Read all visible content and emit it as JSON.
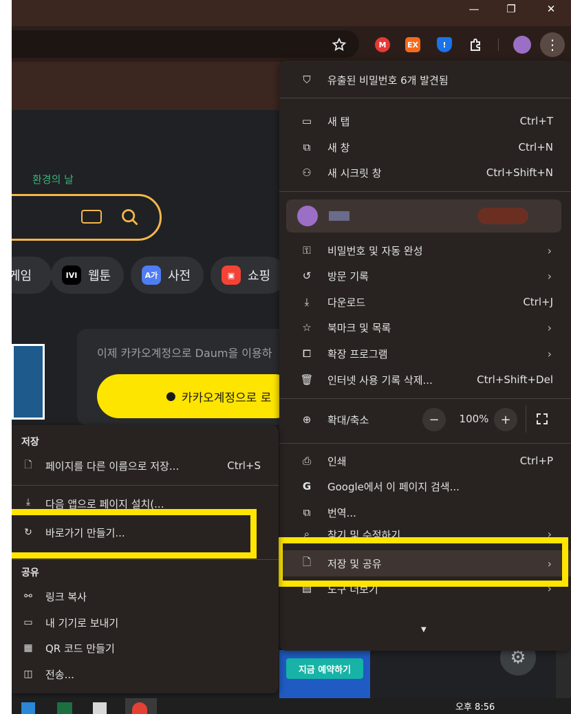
{
  "window": {
    "minimize": "—",
    "restore": "❐",
    "close": "✕"
  },
  "toolbar": {
    "star_icon": "star-icon",
    "extensions": [
      {
        "label": "M",
        "color": "#e53935"
      },
      {
        "label": "EX",
        "color": "#f26b1d"
      },
      {
        "label": "!",
        "color": "#1a73e8"
      }
    ],
    "menu_dots": "⋮"
  },
  "page": {
    "doodle_text": "환경의 날",
    "pills": [
      {
        "label": "게임"
      },
      {
        "label": "웹툰",
        "icon": "IVI",
        "icon_color": "#000000"
      },
      {
        "label": "사전",
        "icon": "A가",
        "icon_color": "#4f7df3"
      },
      {
        "label": "쇼핑",
        "icon": "▣",
        "icon_color": "#f44336"
      }
    ],
    "login_prompt": "이제 카카오계정으로 Daum을 이용하",
    "kakao_button": "카카오계정으로 로",
    "reserve_button": "지금 예약하기"
  },
  "menu": {
    "breach_alert": "유출된 비밀번호 6개 발견됨",
    "new_tab": "새 탭",
    "new_tab_sc": "Ctrl+T",
    "new_window": "새 창",
    "new_window_sc": "Ctrl+N",
    "incognito": "새 시크릿 창",
    "incognito_sc": "Ctrl+Shift+N",
    "profile_name": "",
    "passwords": "비밀번호 및 자동 완성",
    "history": "방문 기록",
    "downloads": "다운로드",
    "downloads_sc": "Ctrl+J",
    "bookmarks": "북마크 및 목록",
    "extensions": "확장 프로그램",
    "clear_data": "인터넷 사용 기록 삭제...",
    "clear_data_sc": "Ctrl+Shift+Del",
    "zoom": "확대/축소",
    "zoom_value": "100%",
    "zoom_minus": "−",
    "zoom_plus": "+",
    "print": "인쇄",
    "print_sc": "Ctrl+P",
    "search_page": "Google에서 이 페이지 검색...",
    "translate": "번역...",
    "find_edit": "찾기 및 수정하기",
    "save_share": "저장 및 공유",
    "more_tools": "도구 더보기"
  },
  "submenu": {
    "save_header": "저장",
    "save_as": "페이지를 다른 이름으로 저장...",
    "save_as_sc": "Ctrl+S",
    "install_app": "다음 앱으로 페이지 설치(...",
    "create_shortcut": "바로가기 만들기...",
    "share_header": "공유",
    "copy_link": "링크 복사",
    "send_device": "내 기기로 보내기",
    "qr_code": "QR 코드 만들기",
    "cast": "전송..."
  },
  "taskbar": {
    "clock": "오후 8:56"
  },
  "colors": {
    "highlight": "#ffe500",
    "menu_bg": "#282321",
    "kakao": "#fee500"
  }
}
